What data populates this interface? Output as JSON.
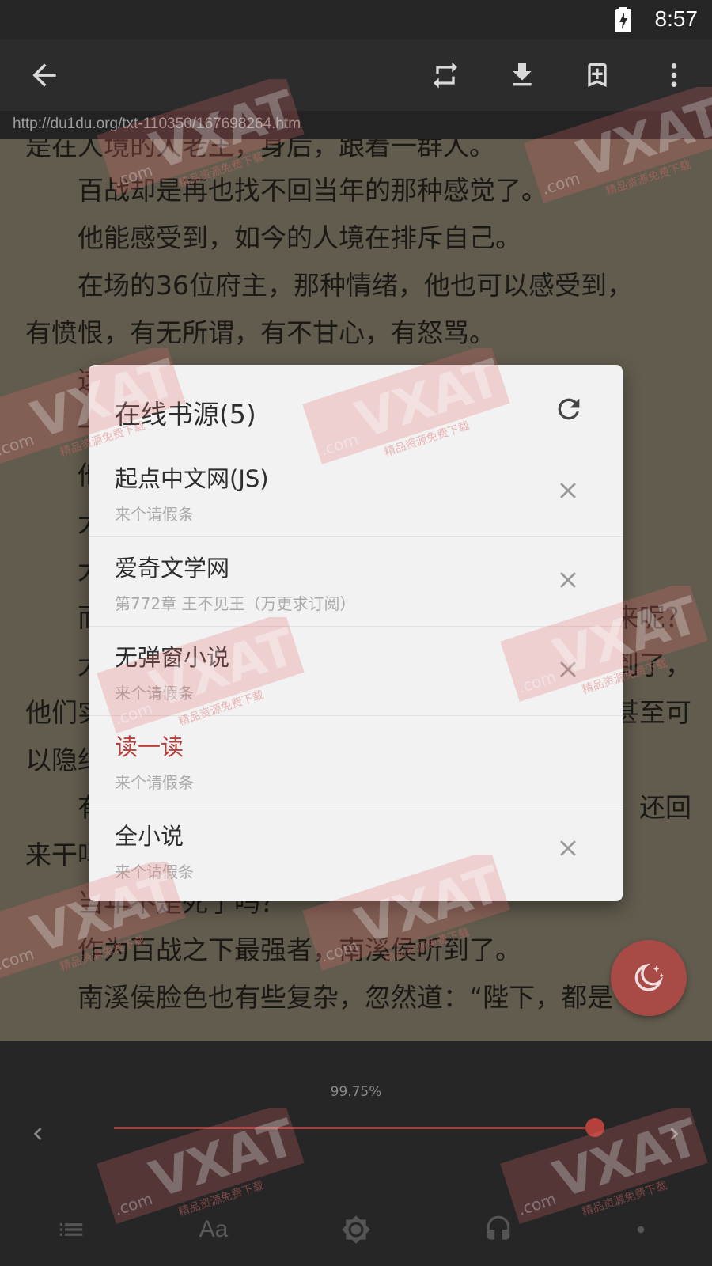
{
  "status": {
    "time": "8:57"
  },
  "toolbar": {
    "url": "http://du1du.org/txt-110350/167698264.htm"
  },
  "reader": {
    "lines": [
      "是在人境的人老王，身后，跟着一群人。",
      "　　百战却是再也找不回当年的那种感觉了。",
      "　　他能感受到，如今的人境在排斥自己。",
      "　　在场的36位府主，那种情绪，他也可以感受到，",
      "有愤恨，有无所谓，有不甘心，有怒骂。",
      "　　这",
      "　　一",
      "　　他",
      "　　大",
      "　　大",
      "　　而",
      "　　大",
      "他们实",
      "以隐约",
      "　　有",
      "来干吗",
      "　　当年不是死了吗？",
      "　　作为百战之下最强者，南溪侯听到了。",
      "　　南溪侯脸色也有些复杂，忽然道：“陛下，都是"
    ],
    "right_fragments": [
      "来呢？",
      "到了，",
      "甚至可",
      "还回"
    ]
  },
  "dialog": {
    "title": "在线书源(5)",
    "sources": [
      {
        "name": "起点中文网(JS)",
        "latest": "来个请假条",
        "active": false
      },
      {
        "name": "爱奇文学网",
        "latest": "第772章 王不见王（万更求订阅）",
        "active": false
      },
      {
        "name": "无弹窗小说",
        "latest": "来个请假条",
        "active": false
      },
      {
        "name": "读一读",
        "latest": "来个请假条",
        "active": true
      },
      {
        "name": "全小说",
        "latest": "来个请假条",
        "active": false
      }
    ]
  },
  "bottom": {
    "progress_label": "99.75%",
    "progress": 0.9975,
    "font_button": "Aa"
  },
  "watermark": {
    "text": "VXAT",
    "domain": ".com",
    "tagline": "精品资源免费下载"
  },
  "colors": {
    "accent": "#b8403b",
    "fab": "#a84b47",
    "reader_bg": "#7e7764",
    "panel_bg": "#262626"
  }
}
